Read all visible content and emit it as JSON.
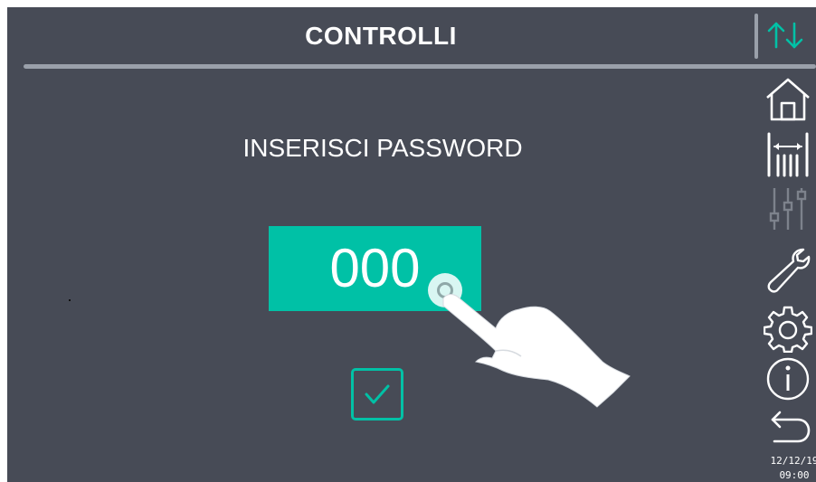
{
  "header": {
    "title": "CONTROLLI"
  },
  "main": {
    "prompt": "INSERISCI PASSWORD",
    "password_value": "000",
    "confirm_icon": "checkmark-icon"
  },
  "sidebar": {
    "items": [
      {
        "icon": "home-icon"
      },
      {
        "icon": "levels-icon"
      },
      {
        "icon": "sliders-icon",
        "disabled": true
      },
      {
        "icon": "wrench-icon"
      },
      {
        "icon": "gear-icon"
      },
      {
        "icon": "info-icon"
      },
      {
        "icon": "back-icon"
      }
    ],
    "top_icon": "up-down-arrows-icon"
  },
  "status": {
    "date": "12/12/19",
    "time": "09:00"
  },
  "colors": {
    "background": "#474b56",
    "accent": "#00c1a6",
    "text": "#ffffff",
    "disabled": "#7d828c"
  }
}
